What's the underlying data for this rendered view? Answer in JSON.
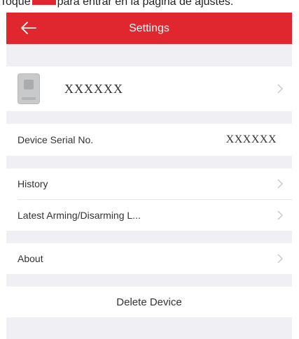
{
  "caption": {
    "before": "Toque",
    "after": "para entrar en la página de ajustes."
  },
  "navbar": {
    "back_icon": "arrow-left-icon",
    "title": "Settings",
    "color": "#e0262e"
  },
  "device": {
    "thumbnail_icon": "device-thumbnail-icon",
    "name": "XXXXXX"
  },
  "serial": {
    "label": "Device Serial No.",
    "value": "XXXXXX"
  },
  "menu": {
    "history": "History",
    "latest_arming": "Latest Arming/Disarming L...",
    "about": "About"
  },
  "delete": {
    "label": "Delete Device"
  }
}
